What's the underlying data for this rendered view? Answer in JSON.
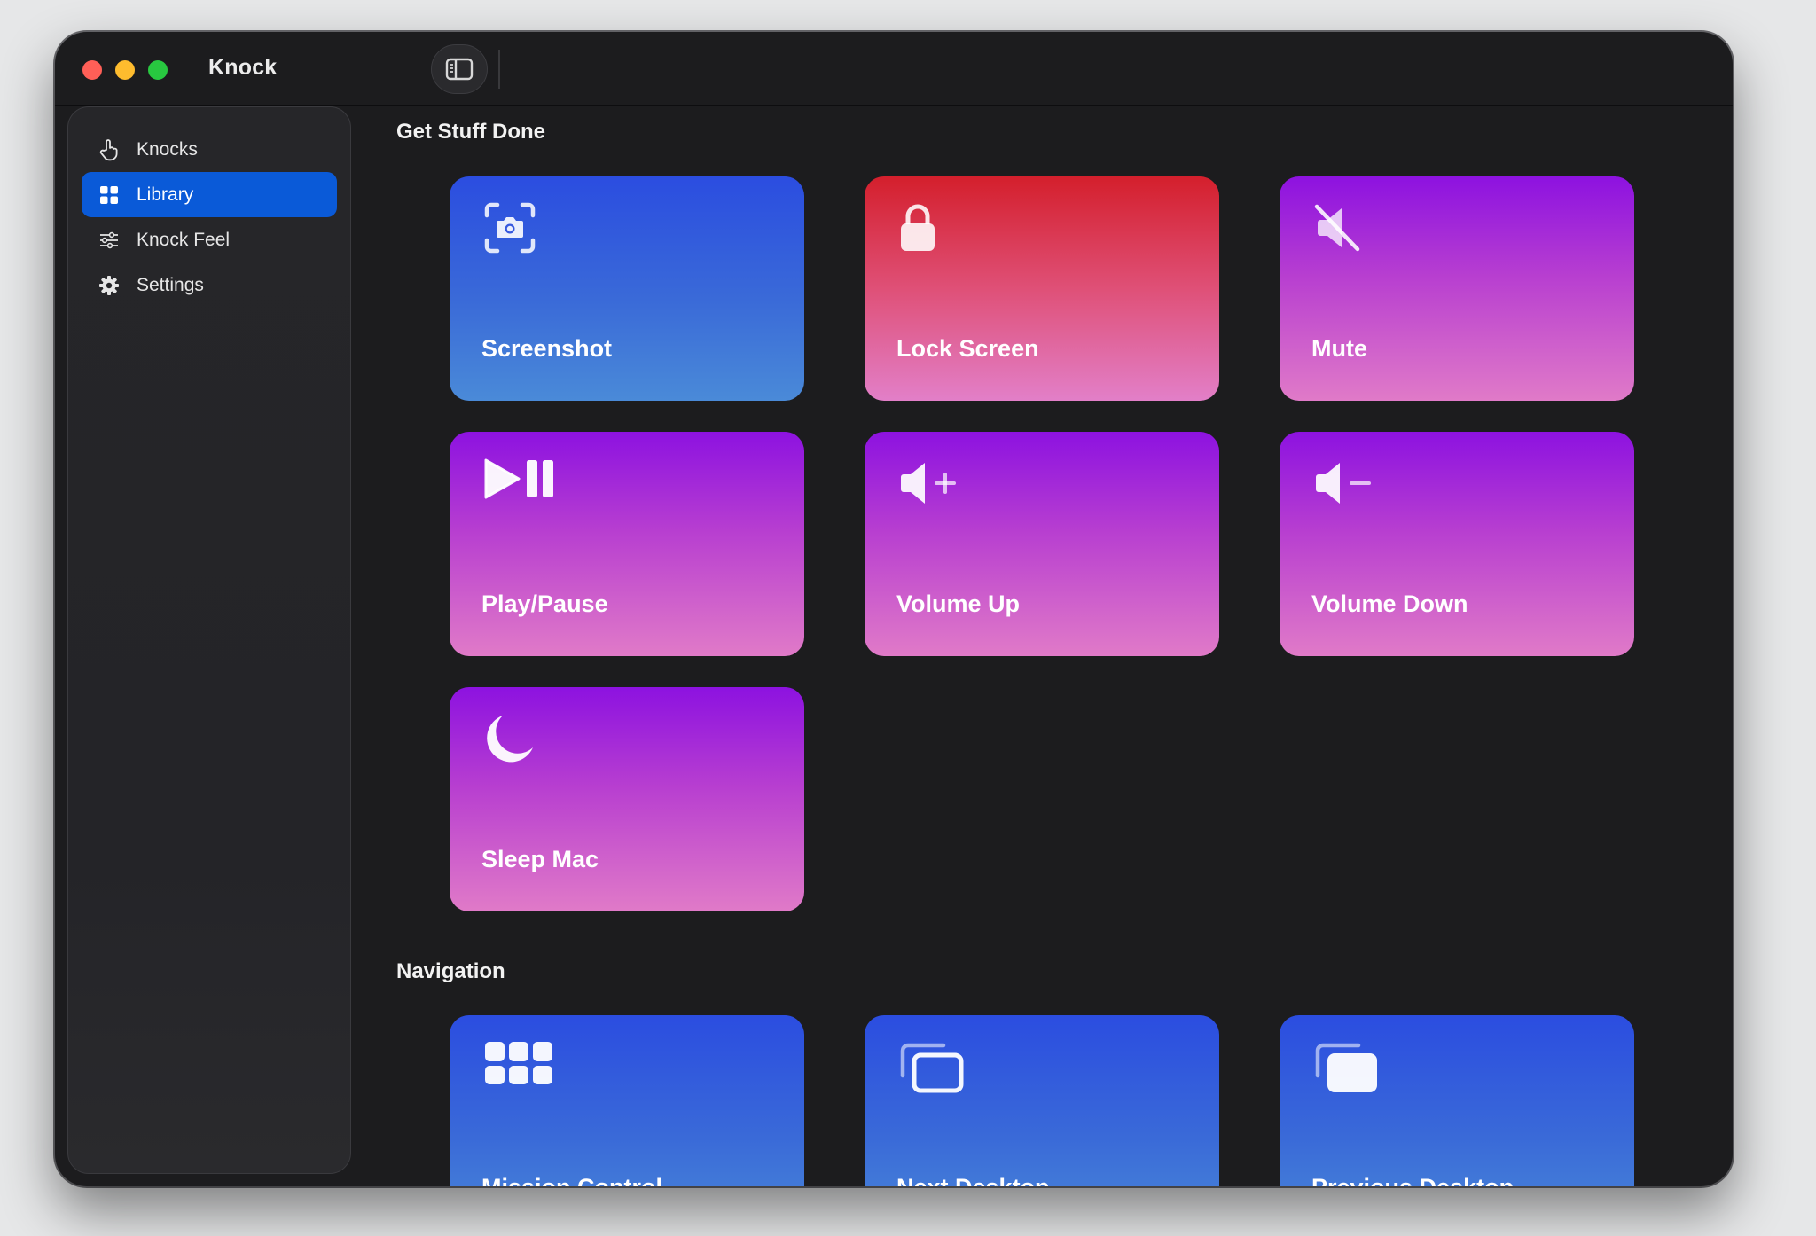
{
  "app": {
    "title": "Knock"
  },
  "sidebar": {
    "items": [
      {
        "label": "Knocks",
        "icon": "hand-pointer-icon",
        "active": false
      },
      {
        "label": "Library",
        "icon": "grid-icon",
        "active": true
      },
      {
        "label": "Knock Feel",
        "icon": "sliders-icon",
        "active": false
      },
      {
        "label": "Settings",
        "icon": "gear-icon",
        "active": false
      }
    ]
  },
  "sections": [
    {
      "title": "Get Stuff Done",
      "actions": [
        {
          "label": "Screenshot",
          "icon": "camera-viewfinder-icon",
          "color": "blue"
        },
        {
          "label": "Lock Screen",
          "icon": "lock-icon",
          "color": "red"
        },
        {
          "label": "Mute",
          "icon": "speaker-slash-icon",
          "color": "purple"
        },
        {
          "label": "Play/Pause",
          "icon": "play-pause-icon",
          "color": "purple"
        },
        {
          "label": "Volume Up",
          "icon": "speaker-plus-icon",
          "color": "purple"
        },
        {
          "label": "Volume Down",
          "icon": "speaker-minus-icon",
          "color": "purple"
        },
        {
          "label": "Sleep Mac",
          "icon": "moon-icon",
          "color": "purple"
        }
      ]
    },
    {
      "title": "Navigation",
      "actions": [
        {
          "label": "Mission Control",
          "icon": "app-grid-icon",
          "color": "blue"
        },
        {
          "label": "Next Desktop",
          "icon": "windows-forward-icon",
          "color": "blue"
        },
        {
          "label": "Previous Desktop",
          "icon": "windows-back-icon",
          "color": "blue"
        }
      ]
    }
  ],
  "colors": {
    "accent": "#0a5ad8",
    "card_blue": "#2b4de0",
    "card_red": "#d41f2c",
    "card_purple": "#8d12e0"
  }
}
